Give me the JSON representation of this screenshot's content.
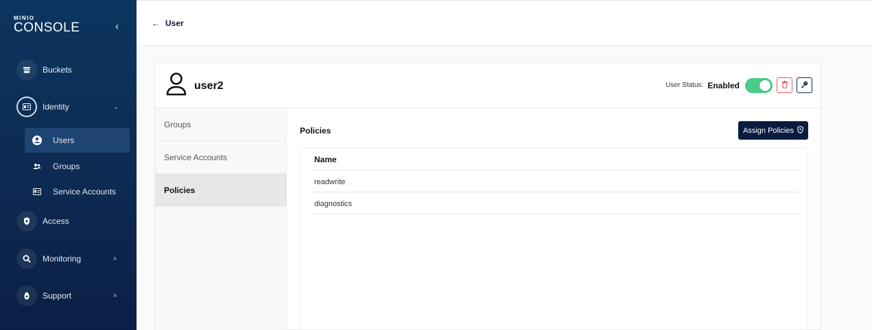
{
  "sidebar": {
    "logo_top": "MINIO",
    "logo_main": "CONSOLE",
    "nav": {
      "buckets": "Buckets",
      "identity": "Identity",
      "users": "Users",
      "groups": "Groups",
      "service_accounts": "Service Accounts",
      "access": "Access",
      "monitoring": "Monitoring",
      "support": "Support"
    },
    "icons": [
      "chevron-left-icon",
      "bucket-icon",
      "identity-icon",
      "user-icon",
      "groups-icon",
      "service-accounts-icon",
      "lock-icon",
      "search-icon",
      "support-icon"
    ]
  },
  "topbar": {
    "back_label": "User"
  },
  "user": {
    "name": "user2",
    "status_label": "User Status:",
    "status_value": "Enabled",
    "enabled": true
  },
  "tabs": [
    "Groups",
    "Service Accounts",
    "Policies"
  ],
  "active_tab": "Policies",
  "policies": {
    "title": "Policies",
    "assign_label": "Assign Policies",
    "column_name": "Name",
    "rows": [
      "readwrite",
      "diagnostics"
    ]
  },
  "colors": {
    "sidebar": "#0d2a52",
    "primary": "#081c42",
    "toggle_on": "#4ccb8d",
    "delete": "#e45a5a"
  }
}
